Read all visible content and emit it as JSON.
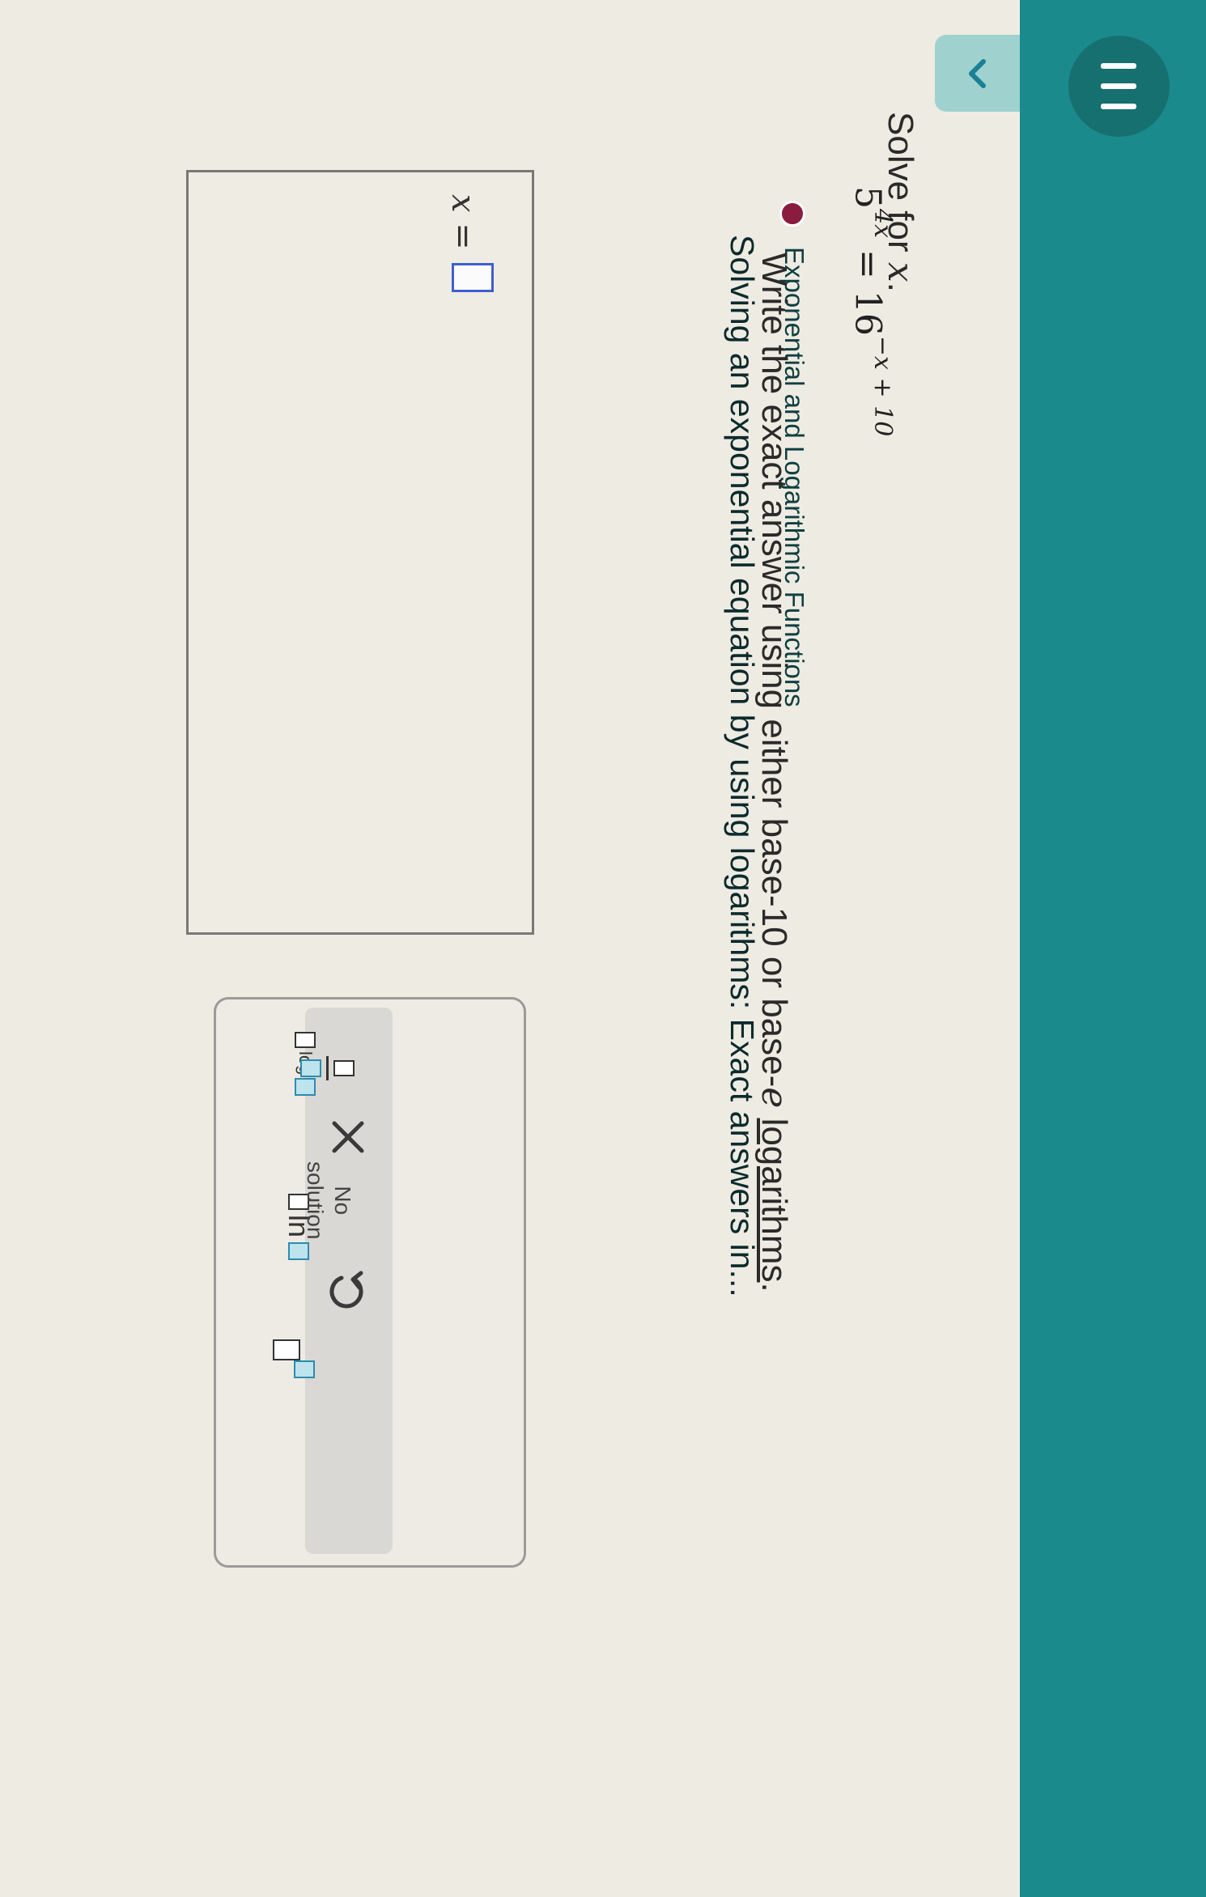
{
  "header": {
    "menu_icon": "hamburger-menu-icon",
    "status_color": "#8a1c3f",
    "breadcrumb": "Exponential and Logarithmic Functions",
    "lesson_title": "Solving an exponential equation by using logarithms: Exact answers in..."
  },
  "collapse_icon": "chevron-down-icon",
  "problem": {
    "prompt": "Solve for",
    "variable": "x",
    "period": ".",
    "equation": {
      "base_left": "5",
      "exp_left": "4x",
      "equals": " = ",
      "base_right": "16",
      "exp_right": "−x + 10"
    },
    "instruction_start": "Write the exact answer using either base-10 or base-",
    "instruction_e": "e",
    "instruction_mid": " ",
    "instruction_link": "logarithms",
    "instruction_end": "."
  },
  "answer": {
    "label": "x =",
    "value": ""
  },
  "keypad": {
    "log_key": "log",
    "ln_key": "ln",
    "no_solution_line1": "No",
    "no_solution_line2": "solution",
    "clear_icon": "close-icon",
    "undo_icon": "undo-icon"
  },
  "colors": {
    "header_bg": "#1b8a8d",
    "accent_blue": "#3f5fd0",
    "tab_bg": "#9fd1cf"
  }
}
